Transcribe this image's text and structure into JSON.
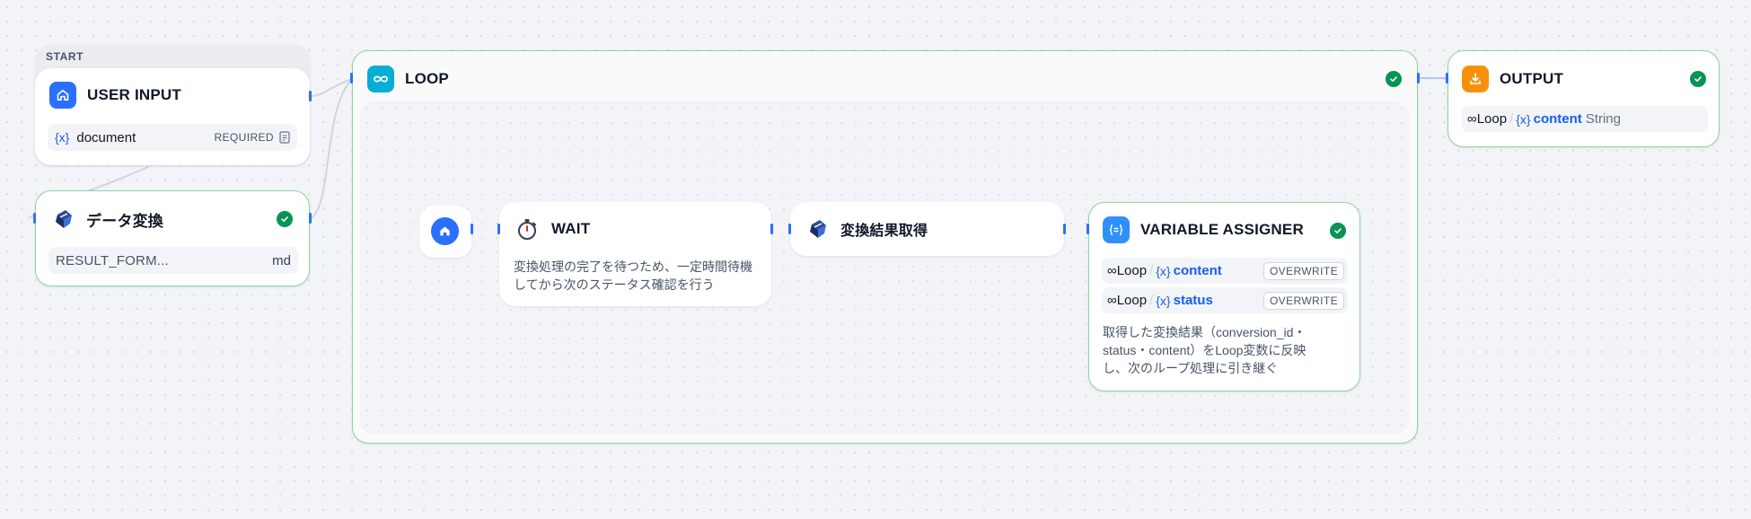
{
  "start": {
    "caption": "START",
    "title": "USER INPUT",
    "variable_icon": "{x}",
    "variable_name": "document",
    "required_label": "REQUIRED"
  },
  "data_convert": {
    "title": "データ変換",
    "field_name": "RESULT_FORM...",
    "field_value": "md"
  },
  "loop": {
    "title": "LOOP",
    "wait": {
      "title": "WAIT",
      "description_line1": "変換処理の完了を待つため、一定時間待機",
      "description_line2": "してから次のステータス確認を行う"
    },
    "fetch": {
      "title": "変換結果取得"
    },
    "assigner": {
      "title": "VARIABLE ASSIGNER",
      "rows": [
        {
          "scope": "Loop",
          "sep": "/",
          "var_icon": "{x}",
          "var": "content",
          "mode": "OVERWRITE"
        },
        {
          "scope": "Loop",
          "sep": "/",
          "var_icon": "{x}",
          "var": "status",
          "mode": "OVERWRITE"
        }
      ],
      "description_line1": "取得した変換結果（conversion_id・",
      "description_line2": "status・content）をLoop変数に反映",
      "description_line3": "し、次のループ処理に引き継ぐ"
    }
  },
  "output": {
    "title": "OUTPUT",
    "scope": "Loop",
    "sep": "/",
    "var_icon": "{x}",
    "var": "content",
    "type": "String"
  },
  "colors": {
    "start_icon": "#2970ff",
    "loop_icon": "#06aed4",
    "output_icon": "#f79009",
    "assigner_icon": "#2e90fa",
    "success": "#079455",
    "node_border_success": "#8fd3a4",
    "link_blue": "#155eef"
  },
  "icons": {
    "start": "home-icon",
    "loop": "infinity-icon",
    "wait": "stopwatch-icon",
    "tool": "plugin-icon",
    "assigner": "variable-assigner-icon",
    "output": "output-icon",
    "status": "check-circle-icon"
  }
}
